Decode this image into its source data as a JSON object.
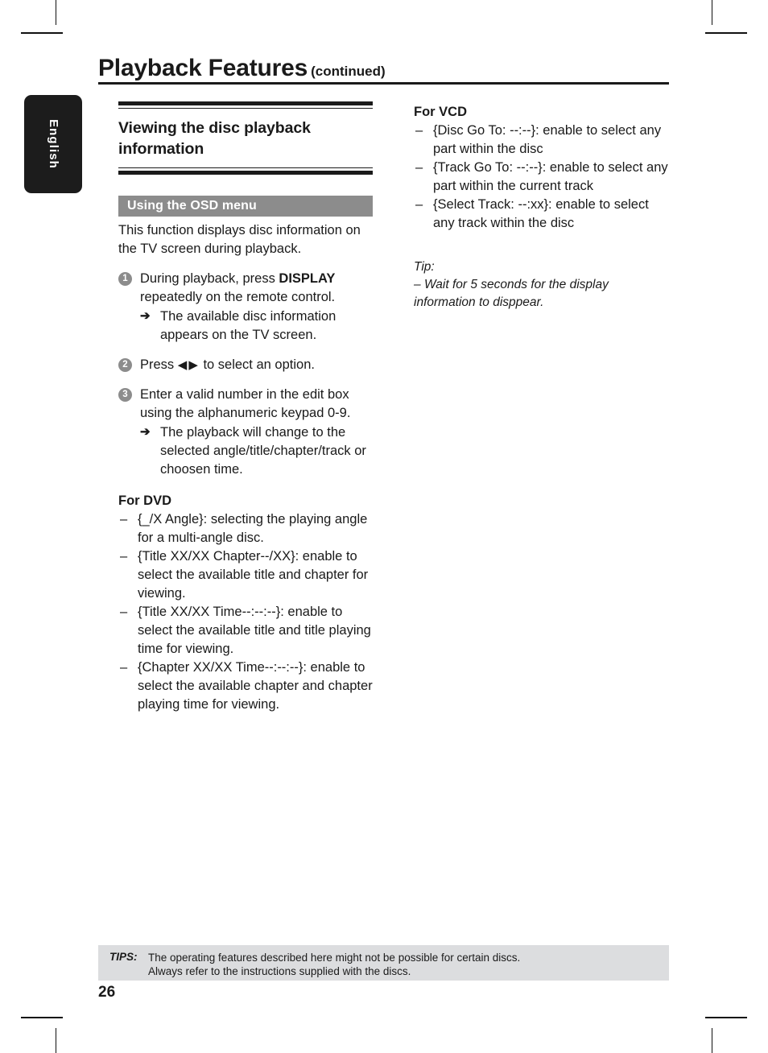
{
  "header": {
    "title": "Playback Features",
    "continued": "(continued)"
  },
  "language_tab": {
    "label": "English"
  },
  "left_column": {
    "section_heading": "Viewing the disc playback information",
    "subsection_bar": "Using the OSD menu",
    "intro": "This function displays disc information on the TV screen during playback.",
    "steps": [
      {
        "number": "1",
        "text_before": "During playback, press ",
        "bold": "DISPLAY",
        "text_after": " repeatedly on the remote control.",
        "result_arrow": "➔",
        "result": "The available disc information appears on the TV screen."
      },
      {
        "number": "2",
        "text_before": "Press ",
        "left_triangle": "◀",
        "right_triangle": "▶",
        "text_after": " to select an option."
      },
      {
        "number": "3",
        "text_before": "Enter a valid number in the edit box using the alphanumeric keypad 0-9.",
        "result_arrow": "➔",
        "result": "The playback will change to the selected angle/title/chapter/track or choosen time."
      }
    ],
    "dvd_heading": "For DVD",
    "dvd_items": [
      "{_/X Angle}: selecting the playing angle for a multi-angle disc.",
      "{Title XX/XX Chapter--/XX}: enable to select the available title and chapter for viewing.",
      "{Title XX/XX Time--:--:--}: enable to select the available title and title playing time for viewing.",
      "{Chapter XX/XX Time--:--:--}: enable to select the available chapter and chapter playing time for viewing."
    ],
    "dash": "–"
  },
  "right_column": {
    "vcd_heading": "For VCD",
    "vcd_items": [
      "{Disc Go To: --:--}: enable to select any part within the disc",
      "{Track Go To: --:--}: enable to select any part within the current track",
      "{Select Track: --:xx}: enable to select any track within the disc"
    ],
    "dash": "–",
    "tip_label": "Tip:",
    "tip_dash": "–",
    "tip_text": "Wait for 5 seconds for the display information to disppear."
  },
  "footer": {
    "tips_label": "TIPS:",
    "tips_line1": "The operating features described here might not be possible for certain discs.",
    "tips_line2": "Always refer to the instructions supplied with the discs.",
    "page_number": "26"
  },
  "colors": {
    "ink": "#1a1a1a",
    "gray_bar": "#8c8c8c",
    "tips_background": "#dcdddf",
    "tab_background": "#1c1c1c"
  }
}
